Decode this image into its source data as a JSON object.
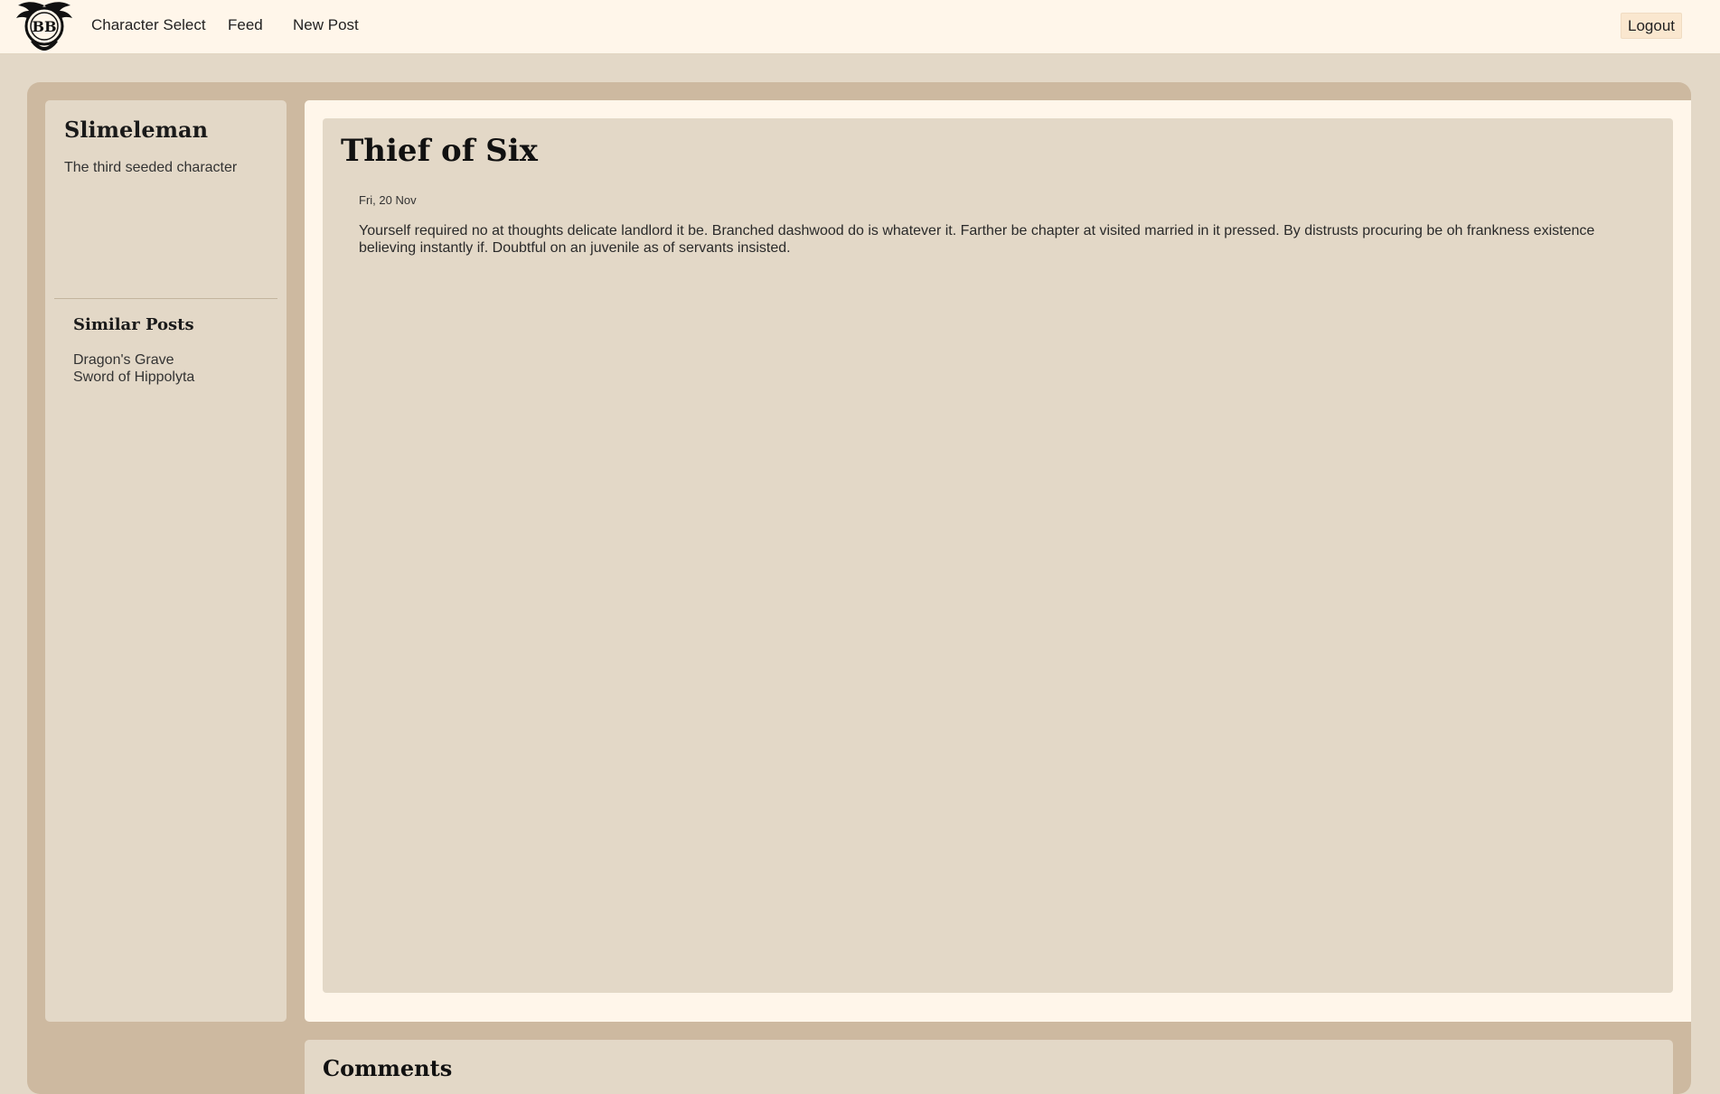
{
  "nav": {
    "logo_text": "BB",
    "links": [
      {
        "label": "Character Select"
      },
      {
        "label": "Feed"
      },
      {
        "label": "New Post"
      }
    ],
    "logout_label": "Logout"
  },
  "sidebar": {
    "character_name": "Slimeleman",
    "character_description": "The third seeded character",
    "similar_posts_title": "Similar Posts",
    "similar_posts": [
      {
        "title": "Dragon's Grave"
      },
      {
        "title": "Sword of Hippolyta"
      }
    ]
  },
  "post": {
    "title": "Thief of Six",
    "date": "Fri, 20 Nov",
    "body": "Yourself required no at thoughts delicate landlord it be. Branched dashwood do is whatever it. Farther be chapter at visited married in it pressed. By distrusts procuring be oh frankness existence believing instantly if. Doubtful on an juvenile as of servants insisted."
  },
  "comments": {
    "title": "Comments"
  },
  "colors": {
    "nav_background": "#fff6ea",
    "page_background": "#e3d8c7",
    "container_background": "#cdb9a0",
    "logout_background": "#fae7cf"
  }
}
